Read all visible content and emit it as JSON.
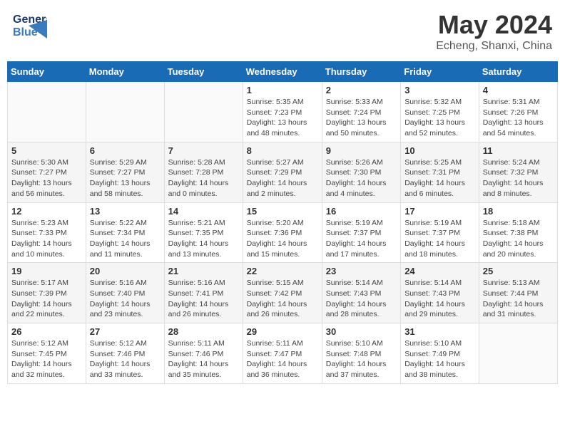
{
  "header": {
    "logo_general": "General",
    "logo_blue": "Blue",
    "month_year": "May 2024",
    "location": "Echeng, Shanxi, China"
  },
  "days_of_week": [
    "Sunday",
    "Monday",
    "Tuesday",
    "Wednesday",
    "Thursday",
    "Friday",
    "Saturday"
  ],
  "weeks": [
    [
      {
        "day": "",
        "info": ""
      },
      {
        "day": "",
        "info": ""
      },
      {
        "day": "",
        "info": ""
      },
      {
        "day": "1",
        "info": "Sunrise: 5:35 AM\nSunset: 7:23 PM\nDaylight: 13 hours\nand 48 minutes."
      },
      {
        "day": "2",
        "info": "Sunrise: 5:33 AM\nSunset: 7:24 PM\nDaylight: 13 hours\nand 50 minutes."
      },
      {
        "day": "3",
        "info": "Sunrise: 5:32 AM\nSunset: 7:25 PM\nDaylight: 13 hours\nand 52 minutes."
      },
      {
        "day": "4",
        "info": "Sunrise: 5:31 AM\nSunset: 7:26 PM\nDaylight: 13 hours\nand 54 minutes."
      }
    ],
    [
      {
        "day": "5",
        "info": "Sunrise: 5:30 AM\nSunset: 7:27 PM\nDaylight: 13 hours\nand 56 minutes."
      },
      {
        "day": "6",
        "info": "Sunrise: 5:29 AM\nSunset: 7:27 PM\nDaylight: 13 hours\nand 58 minutes."
      },
      {
        "day": "7",
        "info": "Sunrise: 5:28 AM\nSunset: 7:28 PM\nDaylight: 14 hours\nand 0 minutes."
      },
      {
        "day": "8",
        "info": "Sunrise: 5:27 AM\nSunset: 7:29 PM\nDaylight: 14 hours\nand 2 minutes."
      },
      {
        "day": "9",
        "info": "Sunrise: 5:26 AM\nSunset: 7:30 PM\nDaylight: 14 hours\nand 4 minutes."
      },
      {
        "day": "10",
        "info": "Sunrise: 5:25 AM\nSunset: 7:31 PM\nDaylight: 14 hours\nand 6 minutes."
      },
      {
        "day": "11",
        "info": "Sunrise: 5:24 AM\nSunset: 7:32 PM\nDaylight: 14 hours\nand 8 minutes."
      }
    ],
    [
      {
        "day": "12",
        "info": "Sunrise: 5:23 AM\nSunset: 7:33 PM\nDaylight: 14 hours\nand 10 minutes."
      },
      {
        "day": "13",
        "info": "Sunrise: 5:22 AM\nSunset: 7:34 PM\nDaylight: 14 hours\nand 11 minutes."
      },
      {
        "day": "14",
        "info": "Sunrise: 5:21 AM\nSunset: 7:35 PM\nDaylight: 14 hours\nand 13 minutes."
      },
      {
        "day": "15",
        "info": "Sunrise: 5:20 AM\nSunset: 7:36 PM\nDaylight: 14 hours\nand 15 minutes."
      },
      {
        "day": "16",
        "info": "Sunrise: 5:19 AM\nSunset: 7:37 PM\nDaylight: 14 hours\nand 17 minutes."
      },
      {
        "day": "17",
        "info": "Sunrise: 5:19 AM\nSunset: 7:37 PM\nDaylight: 14 hours\nand 18 minutes."
      },
      {
        "day": "18",
        "info": "Sunrise: 5:18 AM\nSunset: 7:38 PM\nDaylight: 14 hours\nand 20 minutes."
      }
    ],
    [
      {
        "day": "19",
        "info": "Sunrise: 5:17 AM\nSunset: 7:39 PM\nDaylight: 14 hours\nand 22 minutes."
      },
      {
        "day": "20",
        "info": "Sunrise: 5:16 AM\nSunset: 7:40 PM\nDaylight: 14 hours\nand 23 minutes."
      },
      {
        "day": "21",
        "info": "Sunrise: 5:16 AM\nSunset: 7:41 PM\nDaylight: 14 hours\nand 26 minutes."
      },
      {
        "day": "22",
        "info": "Sunrise: 5:15 AM\nSunset: 7:42 PM\nDaylight: 14 hours\nand 26 minutes."
      },
      {
        "day": "23",
        "info": "Sunrise: 5:14 AM\nSunset: 7:43 PM\nDaylight: 14 hours\nand 28 minutes."
      },
      {
        "day": "24",
        "info": "Sunrise: 5:14 AM\nSunset: 7:43 PM\nDaylight: 14 hours\nand 29 minutes."
      },
      {
        "day": "25",
        "info": "Sunrise: 5:13 AM\nSunset: 7:44 PM\nDaylight: 14 hours\nand 31 minutes."
      }
    ],
    [
      {
        "day": "26",
        "info": "Sunrise: 5:12 AM\nSunset: 7:45 PM\nDaylight: 14 hours\nand 32 minutes."
      },
      {
        "day": "27",
        "info": "Sunrise: 5:12 AM\nSunset: 7:46 PM\nDaylight: 14 hours\nand 33 minutes."
      },
      {
        "day": "28",
        "info": "Sunrise: 5:11 AM\nSunset: 7:46 PM\nDaylight: 14 hours\nand 35 minutes."
      },
      {
        "day": "29",
        "info": "Sunrise: 5:11 AM\nSunset: 7:47 PM\nDaylight: 14 hours\nand 36 minutes."
      },
      {
        "day": "30",
        "info": "Sunrise: 5:10 AM\nSunset: 7:48 PM\nDaylight: 14 hours\nand 37 minutes."
      },
      {
        "day": "31",
        "info": "Sunrise: 5:10 AM\nSunset: 7:49 PM\nDaylight: 14 hours\nand 38 minutes."
      },
      {
        "day": "",
        "info": ""
      }
    ]
  ]
}
